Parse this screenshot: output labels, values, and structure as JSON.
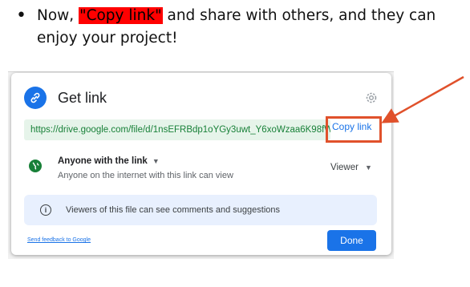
{
  "instruction": {
    "bullet": "•",
    "before": "Now, ",
    "highlight": "\"Copy link\"",
    "after": " and share with others, and they can enjoy your project!"
  },
  "dialog": {
    "title": "Get link",
    "icons": {
      "header": "link-icon",
      "settings": "gear-icon",
      "access": "globe-icon",
      "info": "info-icon"
    },
    "url": "https://drive.google.com/file/d/1nsEFRBdp1oYGy3uwt_Y6xoWzaa6K98fW/...",
    "copy_label": "Copy link",
    "access_title": "Anyone with the link",
    "access_sub": "Anyone on the internet with this link can view",
    "role": "Viewer",
    "info": "Viewers of this file can see comments and suggestions",
    "feedback": "Send feedback to Google",
    "done_label": "Done"
  },
  "colors": {
    "accent": "#1a73e8",
    "url_green": "#188038",
    "annotation": "#e0512b",
    "highlight": "#ff0000"
  }
}
